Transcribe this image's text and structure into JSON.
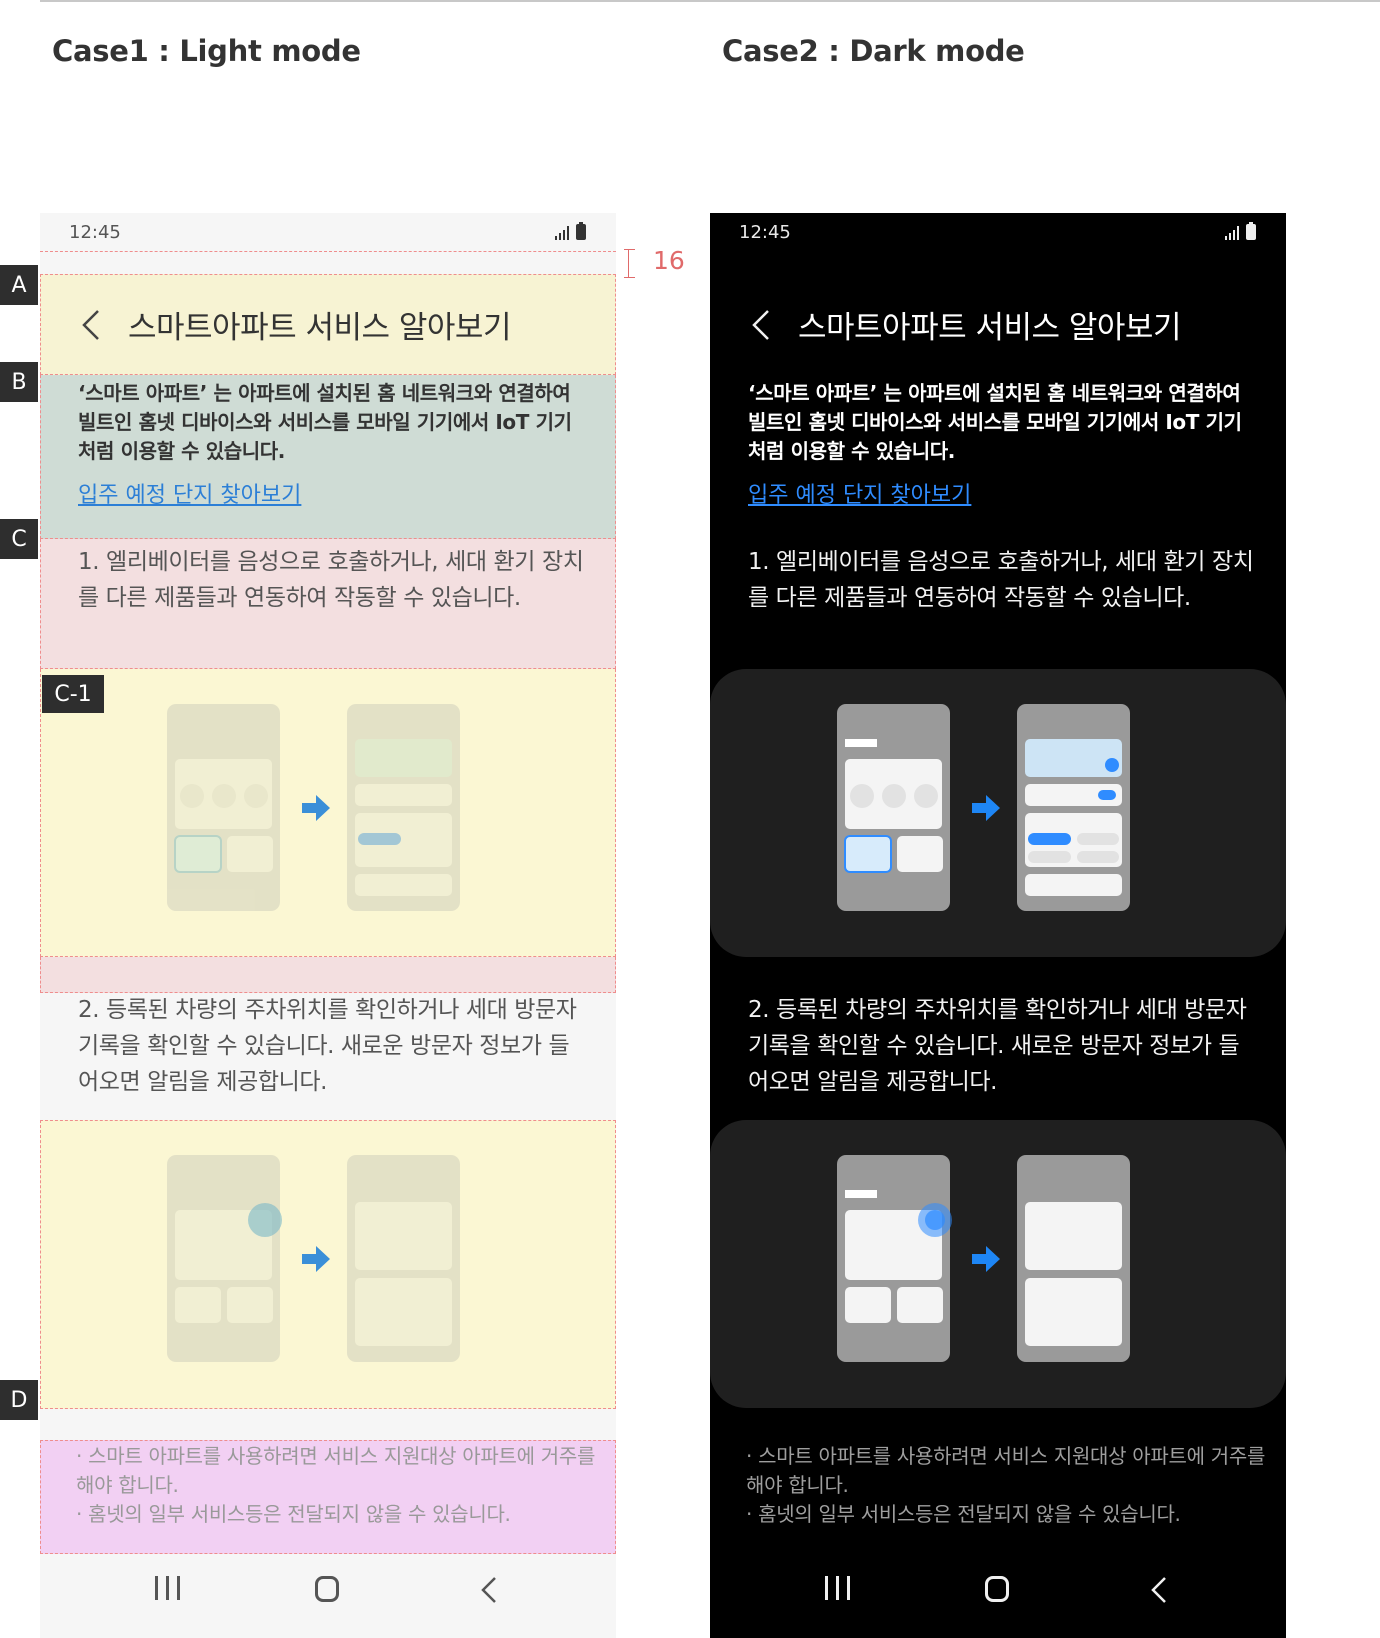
{
  "cases": {
    "light_title": "Case1 : Light mode",
    "dark_title": "Case2 : Dark mode"
  },
  "annotations": {
    "markers": {
      "a": "A",
      "b": "B",
      "c": "C",
      "c1": "C-1",
      "d": "D"
    },
    "spacing_value": "16"
  },
  "status": {
    "time": "12:45"
  },
  "app": {
    "title": "스마트아파트 서비스 알아보기",
    "intro": "‘스마트 아파트’ 는 아파트에 설치된 홈 네트워크와 연결하여 빌트인 홈넷 디바이스와 서비스를 모바일 기기에서 IoT 기기 처럼 이용할 수 있습니다.",
    "link": "입주 예정 단지 찾아보기",
    "step1": "1. 엘리베이터를 음성으로 호출하거나, 세대 환기 장치를 다른 제품들과 연동하여 작동할 수 있습니다.",
    "step2": "2. 등록된 차량의 주차위치를 확인하거나 세대 방문자 기록을 확인할 수 있습니다. 새로운 방문자 정보가 들어오면 알림을 제공합니다.",
    "note1": "· 스마트 아파트를 사용하려면 서비스 지원대상 아파트에 거주를 해야 합니다.",
    "note2": "· 홈넷의 일부 서비스등은 전달되지 않을 수 있습니다."
  },
  "colors": {
    "overlay_yellow": "#f7f3d3",
    "overlay_green": "#cfdcd5",
    "overlay_pink": "#f3dfe0",
    "overlay_violet": "#f2d0f3",
    "guide_red": "#ef8d8d",
    "link_light": "#2c7fd6",
    "link_dark": "#2f8cff",
    "accent_blue": "#1e86f5"
  },
  "icons": [
    "signal-icon",
    "battery-icon",
    "back-icon",
    "recents-icon",
    "home-icon",
    "back-nav-icon",
    "arrow-right-icon"
  ]
}
